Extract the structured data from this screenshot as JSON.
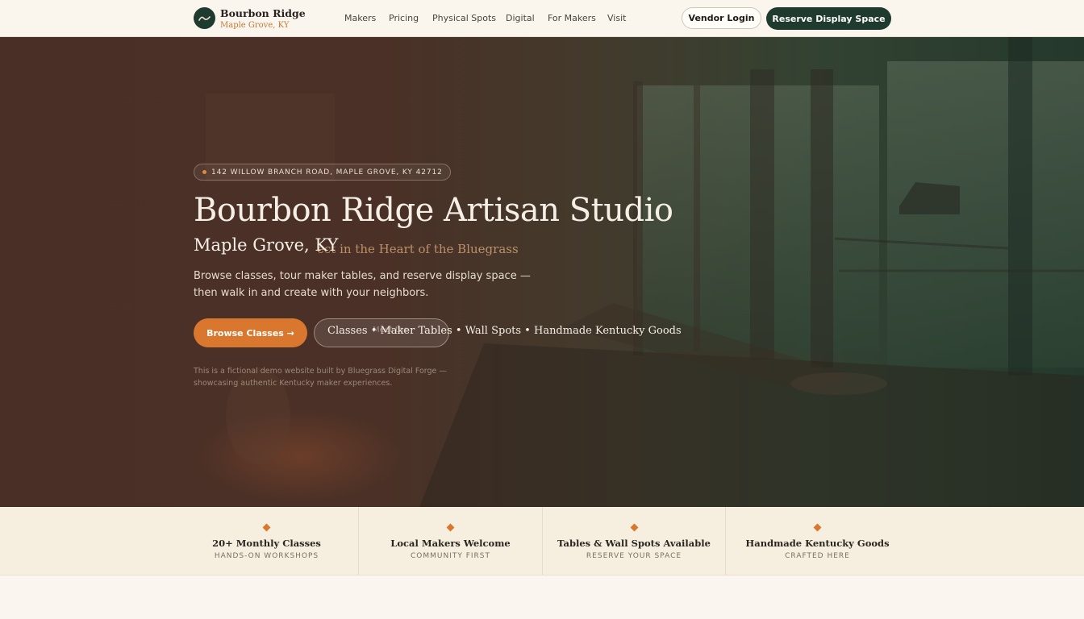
{
  "brand": {
    "name": "Bourbon Ridge",
    "location": "Maple Grove, KY",
    "logo_icon": "mountain-wave-icon"
  },
  "nav": {
    "items": [
      {
        "label": "Makers"
      },
      {
        "label": "Pricing"
      },
      {
        "label": "Physical Spots"
      },
      {
        "label": "Digital"
      },
      {
        "label": "For Makers"
      },
      {
        "label": "Visit"
      }
    ],
    "vendor_login": "Vendor Login",
    "reserve": "Reserve Display Space"
  },
  "hero": {
    "badge": "142 WILLOW BRANCH ROAD, MAPLE GROVE, KY 42712",
    "title": "Bourbon Ridge Artisan Studio",
    "subtitle": "Maple Grove, KY",
    "tagline_ghost": "ect in the Heart of the Bluegrass",
    "description": "Browse classes, tour maker tables, and reserve display space — then walk in and create with your neighbors.",
    "primary_button": "Browse Classes →",
    "ghost_button_text": "Classes • Maker Tables • Wall Spots • Handmade Kentucky Goods",
    "ghost_button_underlay": "Meet the",
    "disclaimer": "This is a fictional demo website built by Bluegrass Digital Forge — showcasing authentic Kentucky maker experiences."
  },
  "features": [
    {
      "title": "20+ Monthly Classes",
      "sub": "HANDS-ON WORKSHOPS"
    },
    {
      "title": "Local Makers Welcome",
      "sub": "COMMUNITY FIRST"
    },
    {
      "title": "Tables & Wall Spots Available",
      "sub": "RESERVE YOUR SPACE"
    },
    {
      "title": "Handmade Kentucky Goods",
      "sub": "CRAFTED HERE"
    }
  ],
  "colors": {
    "accent": "#d9772f",
    "brand_green": "#1f3a2e",
    "cream": "#f6eedf"
  }
}
